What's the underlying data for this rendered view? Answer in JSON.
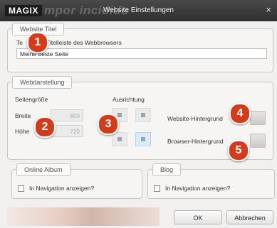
{
  "window": {
    "brand": "MAGIX",
    "ghost_text": "mpor incididu",
    "title": "Website Einstellungen",
    "close_glyph": "×"
  },
  "website_title": {
    "group_label": "Website Titel",
    "field_label": "Titelleiste des Webbrowsers",
    "field_label_prefix": "Te",
    "value": "Meine beste Seite"
  },
  "webdarstellung": {
    "group_label": "Webdarstellung",
    "page_size_label": "Seitengröße",
    "width_label": "Breite",
    "width_value": "800",
    "height_label": "Höhe",
    "height_value": "720",
    "orientation_label": "Ausrichtung",
    "website_bg_label": "Website-Hintergrund",
    "browser_bg_label": "Browser-Hintergrund"
  },
  "online_album": {
    "group_label": "Online Album",
    "checkbox_label": "In Navigation anzeigen?"
  },
  "blog": {
    "group_label": "Blog",
    "checkbox_label": "In Navigation anzeigen?"
  },
  "buttons": {
    "ok": "OK",
    "cancel": "Abbrechen"
  },
  "badges": [
    "1",
    "2",
    "3",
    "4",
    "5"
  ],
  "colors": {
    "badge": "#d23b1c",
    "titlebar": "#3a3a3a"
  }
}
